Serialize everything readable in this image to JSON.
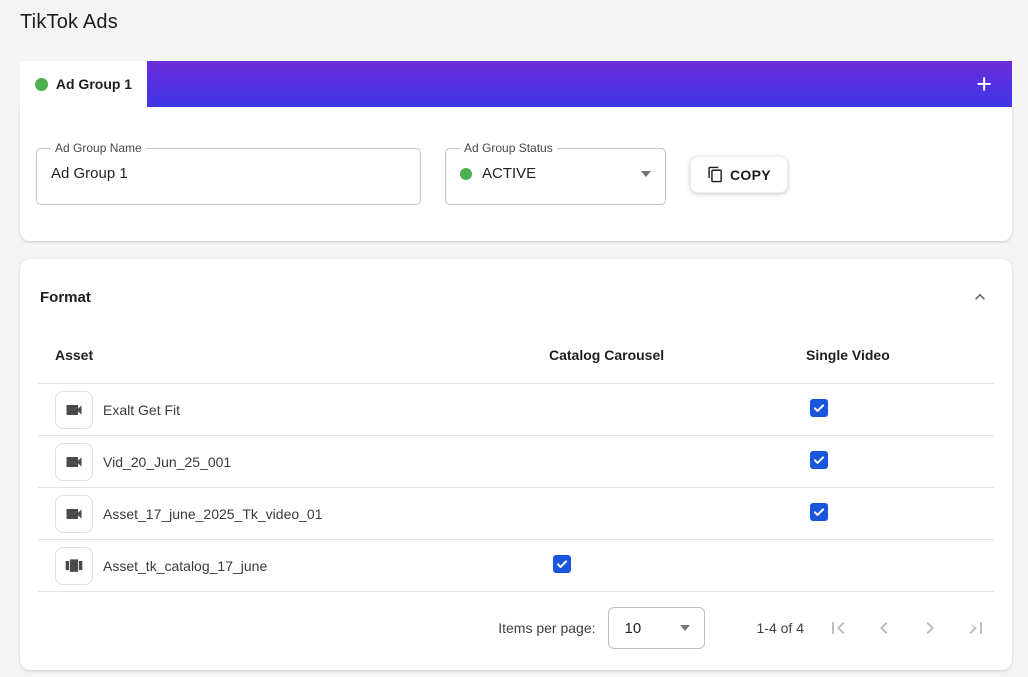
{
  "page": {
    "title": "TikTok Ads"
  },
  "tabs": {
    "active": {
      "label": "Ad Group 1"
    },
    "add_label": "+",
    "gradient": {
      "from": "#6c2bd9",
      "to": "#3e36e7"
    }
  },
  "ad_group_form": {
    "name_field": {
      "label": "Ad Group Name",
      "value": "Ad Group 1"
    },
    "status_field": {
      "label": "Ad Group Status",
      "value": "ACTIVE"
    },
    "copy_button_label": "COPY"
  },
  "format_section": {
    "title": "Format",
    "table": {
      "columns": [
        "Asset",
        "Catalog Carousel",
        "Single Video"
      ],
      "rows": [
        {
          "name": "Exalt Get Fit",
          "asset_type": "video",
          "catalog_carousel": false,
          "single_video": true
        },
        {
          "name": "Vid_20_Jun_25_001",
          "asset_type": "video",
          "catalog_carousel": false,
          "single_video": true
        },
        {
          "name": "Asset_17_june_2025_Tk_video_01",
          "asset_type": "video",
          "catalog_carousel": false,
          "single_video": true
        },
        {
          "name": "Asset_tk_catalog_17_june",
          "asset_type": "carousel",
          "catalog_carousel": true,
          "single_video": false
        }
      ]
    },
    "pagination": {
      "items_per_page_label": "Items per page:",
      "items_per_page_value": "10",
      "range_label": "1-4 of 4"
    }
  },
  "colors": {
    "accent_green": "#4caf50",
    "checkbox_blue": "#1a56db",
    "tab_gradient_top": "#6c2bd9",
    "tab_gradient_bottom": "#3e36e7",
    "page_background": "#f4f4f5"
  },
  "icons": {
    "add": "+",
    "copy": "content-copy",
    "collapse": "chevron-up",
    "video_asset": "videocam",
    "carousel_asset": "view-carousel",
    "select_caret": "caret-down",
    "checked": "check",
    "first_page": "|<",
    "prev_page": "<",
    "next_page": ">",
    "last_page": ">|"
  }
}
